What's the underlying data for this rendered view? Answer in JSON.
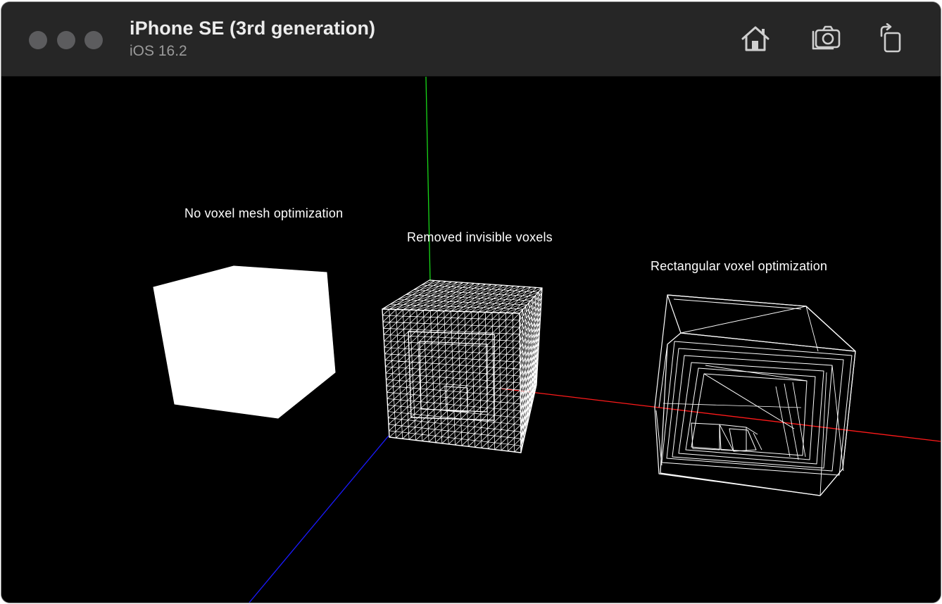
{
  "window": {
    "title": "iPhone SE (3rd generation)",
    "subtitle": "iOS 16.2"
  },
  "toolbar": {
    "home_icon": "home-icon",
    "screenshot_icon": "camera-icon",
    "rotate_icon": "rotate-icon"
  },
  "scene": {
    "labels": [
      "No voxel mesh optimization",
      "Removed invisible voxels",
      "Rectangular voxel optimization"
    ],
    "axis_colors": {
      "x": "#ff1a1a",
      "y": "#18d818",
      "z": "#1a1aff"
    },
    "background": "#000000",
    "wireframe_color": "#ffffff"
  }
}
